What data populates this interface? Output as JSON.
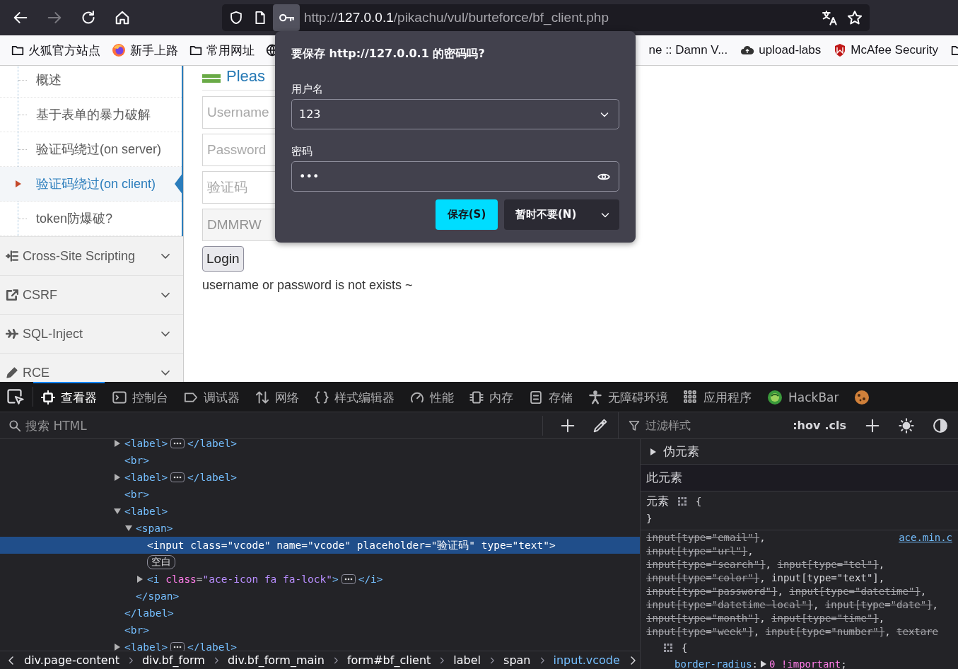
{
  "browser": {
    "forward_disabled": true,
    "password_key_active": true,
    "url": {
      "scheme": "http://",
      "host": "127.0.0.1",
      "path": "/pikachu/vul/burteforce/bf_client.php"
    }
  },
  "bookmarks": {
    "left": [
      {
        "kind": "folder",
        "label": "火狐官方站点"
      },
      {
        "kind": "site",
        "label": "新手上路"
      },
      {
        "kind": "folder",
        "label": "常用网址"
      },
      {
        "kind": "site"
      }
    ],
    "right": [
      {
        "kind": "bare",
        "label": "ne :: Damn V..."
      },
      {
        "kind": "site",
        "label": "upload-labs"
      },
      {
        "kind": "site",
        "label": "McAfee Security"
      },
      {
        "kind": "folder"
      }
    ]
  },
  "sidebar": {
    "subitems": [
      {
        "label": "概述",
        "selected": false
      },
      {
        "label": "基于表单的暴力破解",
        "selected": false
      },
      {
        "label": "验证码绕过(on server)",
        "selected": false
      },
      {
        "label": "验证码绕过(on client)",
        "selected": true
      },
      {
        "label": "token防爆破?",
        "selected": false
      }
    ],
    "groups": [
      {
        "label": "Cross-Site Scripting",
        "expanded": false
      },
      {
        "label": "CSRF",
        "expanded": false
      },
      {
        "label": "SQL-Inject",
        "expanded": false
      },
      {
        "label": "RCE",
        "expanded": false
      }
    ]
  },
  "main": {
    "heading": "Pleas",
    "fields": [
      {
        "kind": "input",
        "placeholder": "Username"
      },
      {
        "kind": "input",
        "placeholder": "Password"
      },
      {
        "kind": "input",
        "placeholder": "验证码"
      },
      {
        "kind": "readonly",
        "value": "DMMRW"
      }
    ],
    "login_button": "Login",
    "message": "username or password is not exists ~"
  },
  "password_popup": {
    "title": "要保存 http://127.0.0.1 的密码吗?",
    "username_label": "用户名",
    "username_value": "123",
    "password_label": "密码",
    "password_value": "•••",
    "save_button": "保存(S)",
    "dismiss_button": "暂时不要(N)"
  },
  "devtools": {
    "tabs": [
      {
        "label": "查看器",
        "selected": true
      },
      {
        "label": "控制台",
        "selected": false
      },
      {
        "label": "调试器",
        "selected": false
      },
      {
        "label": "网络",
        "selected": false
      },
      {
        "label": "样式编辑器",
        "selected": false
      },
      {
        "label": "性能",
        "selected": false
      },
      {
        "label": "内存",
        "selected": false
      },
      {
        "label": "存储",
        "selected": false
      },
      {
        "label": "无障碍环境",
        "selected": false
      },
      {
        "label": "应用程序",
        "selected": false
      },
      {
        "label": "HackBar",
        "selected": false
      },
      {
        "selected": false
      }
    ],
    "search_placeholder": "搜索 HTML",
    "dom_tree": [
      {
        "open": [
          {
            "kind": "tag",
            "text": "<label>"
          }
        ],
        "close": "</label>",
        "expanded": false,
        "selected": false
      },
      {
        "open": [
          {
            "kind": "tag",
            "text": "<br>"
          }
        ],
        "selected": false
      },
      {
        "open": [
          {
            "kind": "tag",
            "text": "<label>"
          }
        ],
        "close": "</label>",
        "expanded": false,
        "selected": false
      },
      {
        "open": [
          {
            "kind": "tag",
            "text": "<br>"
          }
        ],
        "selected": false
      },
      {
        "open": [
          {
            "kind": "tag",
            "text": "<label>"
          }
        ],
        "close": "</label>",
        "expanded": true,
        "selected": false,
        "children": [
          {
            "open": [
              {
                "kind": "tag",
                "text": "<span>"
              }
            ],
            "close": "</span>",
            "expanded": true,
            "selected": false,
            "children": [
              {
                "open": [
                  {
                    "kind": "tag",
                    "text": "<input"
                  },
                  {
                    "kind": "attr",
                    "text": "class"
                  },
                  {
                    "kind": "punct",
                    "text": "="
                  },
                  {
                    "kind": "value",
                    "text": "\"vcode\""
                  },
                  {
                    "kind": "attr",
                    "text": "name"
                  },
                  {
                    "kind": "punct",
                    "text": "="
                  },
                  {
                    "kind": "value",
                    "text": "\"vcode\""
                  },
                  {
                    "kind": "attr",
                    "text": "placeholder"
                  },
                  {
                    "kind": "punct",
                    "text": "="
                  },
                  {
                    "kind": "value",
                    "text": "\"验证码\""
                  },
                  {
                    "kind": "attr",
                    "text": "type"
                  },
                  {
                    "kind": "punct",
                    "text": "="
                  },
                  {
                    "kind": "value",
                    "text": "\"text\""
                  },
                  {
                    "kind": "tag",
                    "text": ">"
                  }
                ],
                "selected": true
              },
              {
                "kind": "whitespace",
                "text": "空白",
                "selected": false
              },
              {
                "open": [
                  {
                    "kind": "tag",
                    "text": "<i"
                  },
                  {
                    "kind": "attr",
                    "text": "class"
                  },
                  {
                    "kind": "punct",
                    "text": "="
                  },
                  {
                    "kind": "value",
                    "text": "\"ace-icon fa fa-lock\""
                  },
                  {
                    "kind": "tag",
                    "text": ">"
                  }
                ],
                "close": "</i>",
                "expanded": false,
                "selected": false
              }
            ]
          }
        ]
      },
      {
        "open": [
          {
            "kind": "tag",
            "text": "<br>"
          }
        ],
        "selected": false
      },
      {
        "open": [
          {
            "kind": "tag",
            "text": "<label>"
          }
        ],
        "close": "</label>",
        "expanded": false,
        "selected": false
      }
    ],
    "breadcrumbs": [
      {
        "label": "div.page-content",
        "selected": false
      },
      {
        "label": "div.bf_form",
        "selected": false
      },
      {
        "label": "div.bf_form_main",
        "selected": false
      },
      {
        "label": "form#bf_client",
        "selected": false
      },
      {
        "label": "label",
        "selected": false
      },
      {
        "label": "span",
        "selected": false
      },
      {
        "label": "input.vcode",
        "selected": true
      }
    ],
    "styles": {
      "filter_placeholder": "过滤样式",
      "hov": ":hov",
      "cls": ".cls",
      "pseudo_section": {
        "label": "伪元素",
        "expanded": false
      },
      "this_element": "此元素",
      "element_rule": {
        "selector": "元素",
        "open": "{",
        "close": "}"
      },
      "rule": {
        "source": "ace.min.c",
        "selector_lines": [
          [
            {
              "kind": "selector",
              "text": "input[type=\"email\"]",
              "matched": false
            },
            {
              "kind": "sep",
              "text": ","
            }
          ],
          [
            {
              "kind": "selector",
              "text": "input[type=\"url\"]",
              "matched": false
            },
            {
              "kind": "sep",
              "text": ","
            }
          ],
          [
            {
              "kind": "selector",
              "text": "input[type=\"search\"]",
              "matched": false
            },
            {
              "kind": "sep",
              "text": ","
            },
            {
              "kind": "selector",
              "text": "input[type=\"tel\"]",
              "matched": false
            },
            {
              "kind": "sep",
              "text": ","
            }
          ],
          [
            {
              "kind": "selector",
              "text": "input[type=\"color\"]",
              "matched": false
            },
            {
              "kind": "sep",
              "text": ","
            },
            {
              "kind": "selector",
              "text": "input[type=\"text\"]",
              "matched": true
            },
            {
              "kind": "sep",
              "text": ","
            }
          ],
          [
            {
              "kind": "selector",
              "text": "input[type=\"password\"]",
              "matched": false
            },
            {
              "kind": "sep",
              "text": ","
            },
            {
              "kind": "selector",
              "text": "input[type=\"datetime\"]",
              "matched": false
            },
            {
              "kind": "sep",
              "text": ","
            }
          ],
          [
            {
              "kind": "selector",
              "text": "input[type=\"datetime-local\"]",
              "matched": false
            },
            {
              "kind": "sep",
              "text": ","
            },
            {
              "kind": "selector",
              "text": "input[type=\"date\"]",
              "matched": false
            },
            {
              "kind": "sep",
              "text": ","
            }
          ],
          [
            {
              "kind": "selector",
              "text": "input[type=\"month\"]",
              "matched": false
            },
            {
              "kind": "sep",
              "text": ","
            },
            {
              "kind": "selector",
              "text": "input[type=\"time\"]",
              "matched": false
            },
            {
              "kind": "sep",
              "text": ","
            }
          ],
          [
            {
              "kind": "selector",
              "text": "input[type=\"week\"]",
              "matched": false
            },
            {
              "kind": "sep",
              "text": ","
            },
            {
              "kind": "selector",
              "text": "input[type=\"number\"]",
              "matched": false
            },
            {
              "kind": "sep",
              "text": ","
            },
            {
              "kind": "selector",
              "text": "textare",
              "matched": false
            }
          ]
        ],
        "open": "{",
        "declarations": [
          {
            "name": "border-radius",
            "colon": ":",
            "value": "0",
            "flag": "!important",
            "semi": ";"
          }
        ]
      }
    }
  }
}
